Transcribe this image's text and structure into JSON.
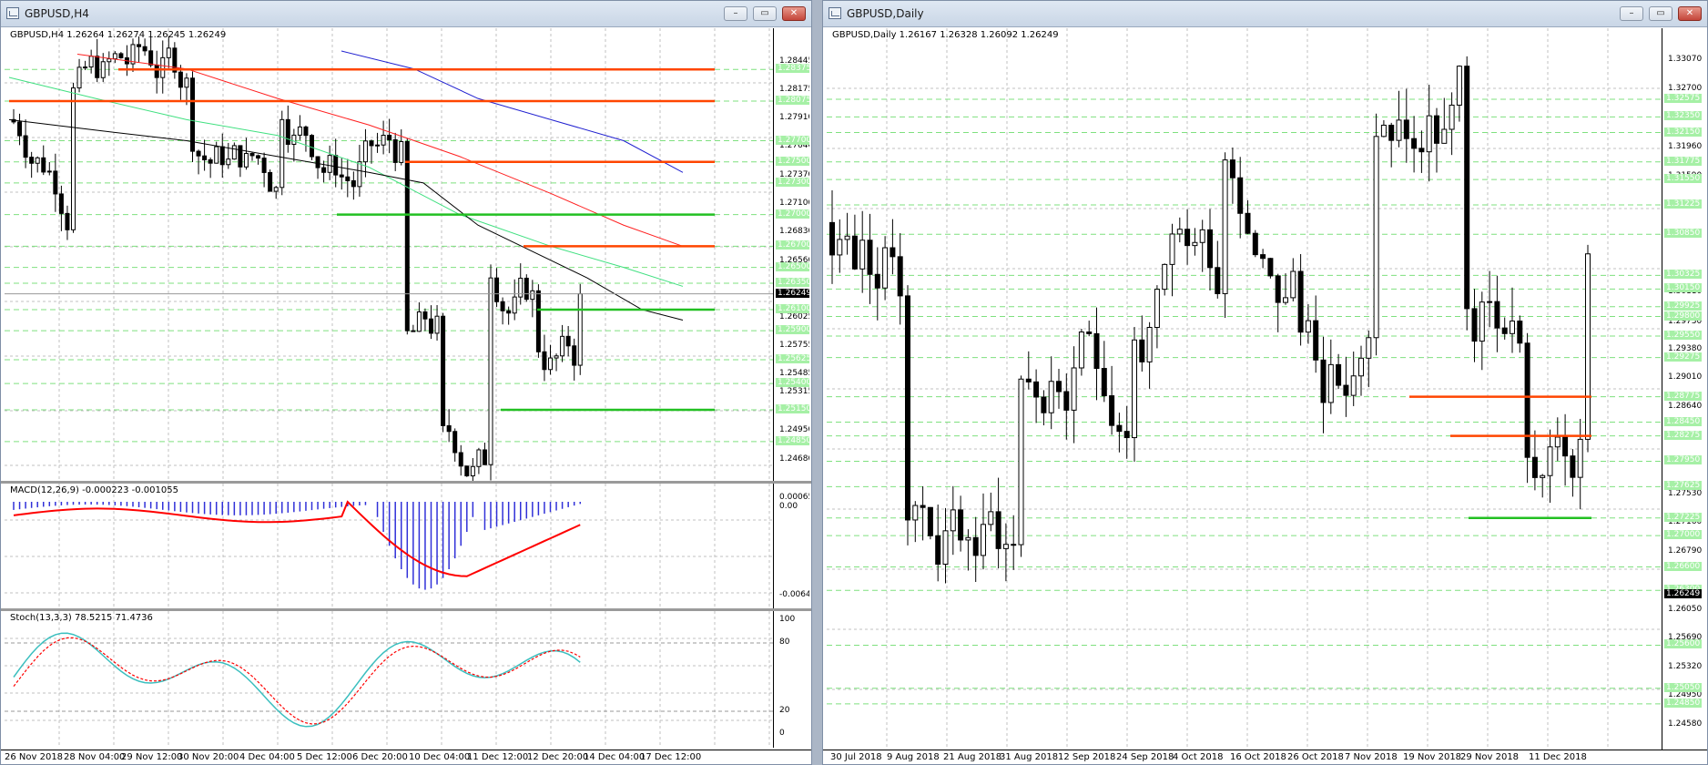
{
  "colors": {
    "bull": "#ffffff",
    "bear": "#000000",
    "grid": "#c0c0c0",
    "level_green_box": "#a6f0a6",
    "resistance": "#ff4500",
    "support": "#22c022",
    "macd_hist": "#3030d8",
    "macd_signal": "#ff0000",
    "stoch_main": "#3bbfbf",
    "stoch_signal": "#ff0000",
    "ma_blue": "#2020d0",
    "ma_red": "#ff2020",
    "ma_green": "#40e080",
    "ma_black": "#000000"
  },
  "windows": [
    {
      "title": "GBPUSD,H4",
      "buttons": {
        "minimize": "–",
        "restore": "▭",
        "close": "✕"
      }
    },
    {
      "title": "GBPUSD,Daily",
      "buttons": {
        "minimize": "–",
        "restore": "▭",
        "close": "✕"
      }
    }
  ],
  "h4": {
    "header": "GBPUSD,H4  1.26264 1.26274 1.26245 1.26249",
    "price_axis": [
      "1.28445",
      "1.28175",
      "1.27910",
      "1.27640",
      "1.27370",
      "1.27100",
      "1.26830",
      "1.26560",
      "1.26025",
      "1.25755",
      "1.25485",
      "1.25315",
      "1.24950",
      "1.24680"
    ],
    "level_labels": [
      "1.28375",
      "1.28075",
      "1.27700",
      "1.27500",
      "1.27300",
      "1.27000",
      "1.26700",
      "1.26500",
      "1.26350",
      "1.26100",
      "1.25900",
      "1.25625",
      "1.25400",
      "1.25150",
      "1.24850"
    ],
    "current_price": "1.26249",
    "macd_header": "MACD(12,26,9) -0.000223 -0.001055",
    "macd_axis": [
      "0.000657",
      "0.00",
      "-0.006494"
    ],
    "stoch_header": "Stoch(13,3,3) 78.5215 71.4736",
    "stoch_axis": [
      "100",
      "80",
      "20",
      "0"
    ],
    "dates": [
      "26 Nov 2018",
      "28 Nov 04:00",
      "29 Nov 12:00",
      "30 Nov 20:00",
      "4 Dec 04:00",
      "5 Dec 12:00",
      "6 Dec 20:00",
      "10 Dec 04:00",
      "11 Dec 12:00",
      "12 Dec 20:00",
      "14 Dec 04:00",
      "17 Dec 12:00"
    ]
  },
  "daily": {
    "header": "GBPUSD,Daily  1.26167 1.26328 1.26092 1.26249",
    "price_axis": [
      "1.33070",
      "1.32700",
      "1.31960",
      "1.31590",
      "1.30850",
      "1.30110",
      "1.29730",
      "1.29380",
      "1.29010",
      "1.28640",
      "1.27530",
      "1.27160",
      "1.26790",
      "1.26050",
      "1.25690",
      "1.25320",
      "1.24950",
      "1.24580"
    ],
    "level_labels": [
      "1.32575",
      "1.32350",
      "1.32150",
      "1.31775",
      "1.31550",
      "1.31225",
      "1.30850",
      "1.30325",
      "1.30150",
      "1.29925",
      "1.29800",
      "1.29550",
      "1.29275",
      "1.28775",
      "1.28450",
      "1.28275",
      "1.27950",
      "1.27625",
      "1.27225",
      "1.27000",
      "1.26600",
      "1.26300",
      "1.25600",
      "1.25050",
      "1.24850"
    ],
    "current_price": "1.26249",
    "dates": [
      "30 Jul 2018",
      "9 Aug 2018",
      "21 Aug 2018",
      "31 Aug 2018",
      "12 Sep 2018",
      "24 Sep 2018",
      "4 Oct 2018",
      "16 Oct 2018",
      "26 Oct 2018",
      "7 Nov 2018",
      "19 Nov 2018",
      "29 Nov 2018",
      "11 Dec 2018"
    ]
  }
}
